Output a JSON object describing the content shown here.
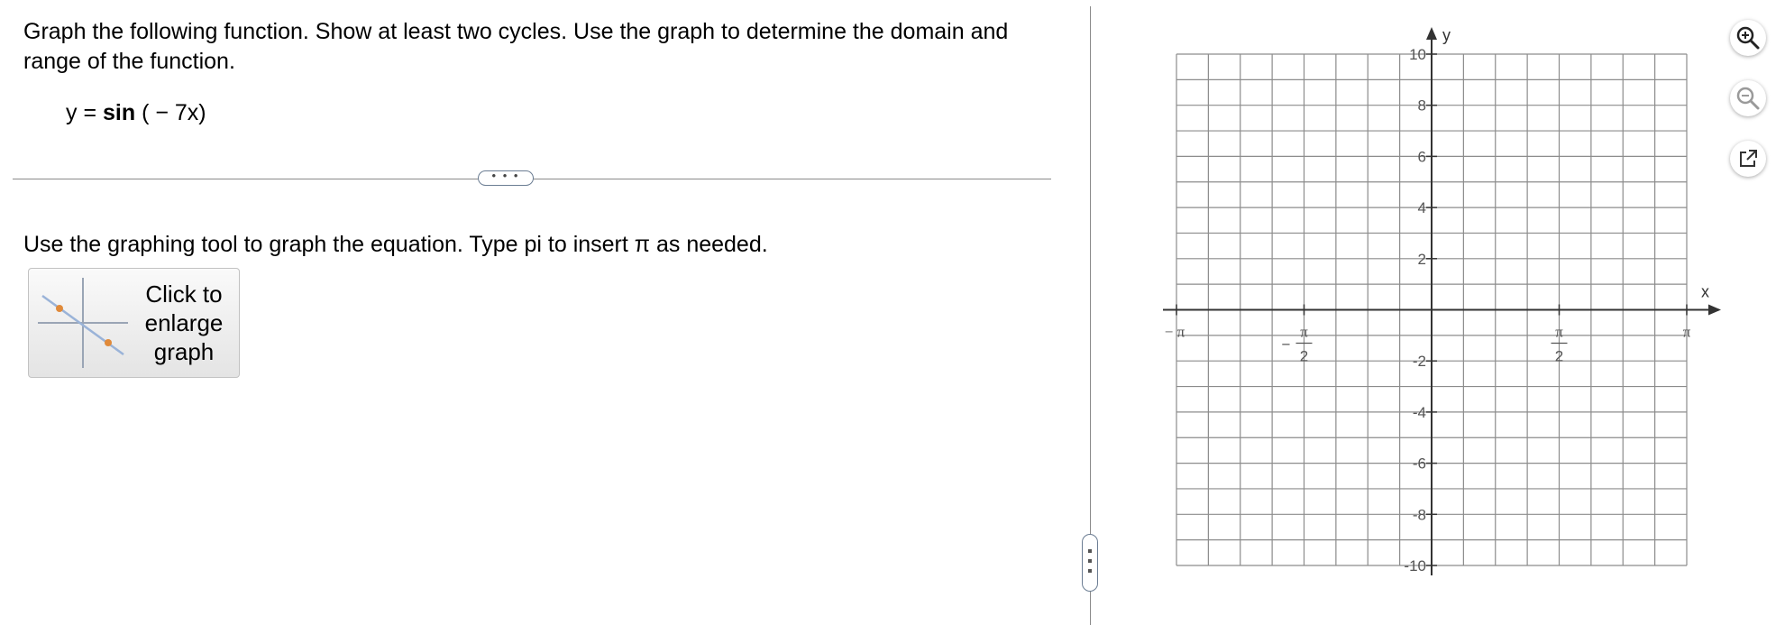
{
  "question": {
    "text": "Graph the following function. Show at least two cycles. Use the graph to determine the domain and range of the function.",
    "equation_lhs": "y = ",
    "equation_func": "sin",
    "equation_arg": " ( − 7x)"
  },
  "collapse_pill_label": "• • •",
  "instruction": "Use the graphing tool to graph the equation. Type pi to insert π as needed.",
  "enlarge_button": {
    "label": "Click to\nenlarge\ngraph"
  },
  "graph": {
    "x_axis_label": "x",
    "y_axis_label": "y",
    "x_ticks": [
      {
        "label": "− π",
        "value": -3.14159
      },
      {
        "label": "− π/2",
        "value": -1.5708
      },
      {
        "label": "π/2",
        "value": 1.5708
      },
      {
        "label": "π",
        "value": 3.14159
      }
    ],
    "y_ticks": [
      {
        "label": "10",
        "value": 10
      },
      {
        "label": "8",
        "value": 8
      },
      {
        "label": "6",
        "value": 6
      },
      {
        "label": "4",
        "value": 4
      },
      {
        "label": "2",
        "value": 2
      },
      {
        "label": "-2",
        "value": -2
      },
      {
        "label": "-4",
        "value": -4
      },
      {
        "label": "-6",
        "value": -6
      },
      {
        "label": "-8",
        "value": -8
      },
      {
        "label": "-10",
        "value": -10
      }
    ],
    "xlim": [
      -3.14159,
      3.14159
    ],
    "ylim": [
      -10,
      10
    ],
    "grid": true,
    "grid_divisions_x": 16,
    "grid_divisions_y": 20
  },
  "tools": {
    "zoom_in": "zoom-in-icon",
    "zoom_out": "zoom-out-icon",
    "popout": "external-link-icon"
  },
  "colors": {
    "grid": "#8c8c8c",
    "axis": "#333333",
    "accent": "#6b7d93"
  }
}
